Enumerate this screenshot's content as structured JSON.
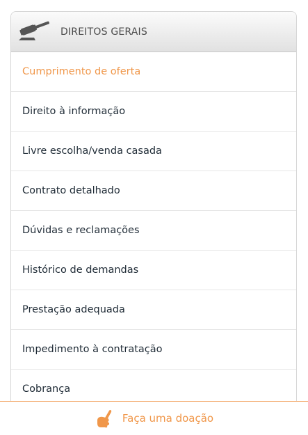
{
  "header": {
    "title": "DIREITOS GERAIS",
    "icon": "gavel-icon"
  },
  "menu": {
    "items": [
      {
        "label": "Cumprimento de oferta",
        "active": true
      },
      {
        "label": "Direito à informação"
      },
      {
        "label": "Livre escolha/venda casada"
      },
      {
        "label": "Contrato detalhado"
      },
      {
        "label": "Dúvidas e reclamações"
      },
      {
        "label": "Histórico de demandas"
      },
      {
        "label": "Prestação adequada"
      },
      {
        "label": "Impedimento à contratação"
      },
      {
        "label": "Cobrança"
      }
    ]
  },
  "footer": {
    "label": "Faça uma doação",
    "icon": "pointing-hand-icon"
  },
  "colors": {
    "accent": "#f0974a",
    "text": "#1f2b36",
    "header_text": "#4a4a4a"
  }
}
